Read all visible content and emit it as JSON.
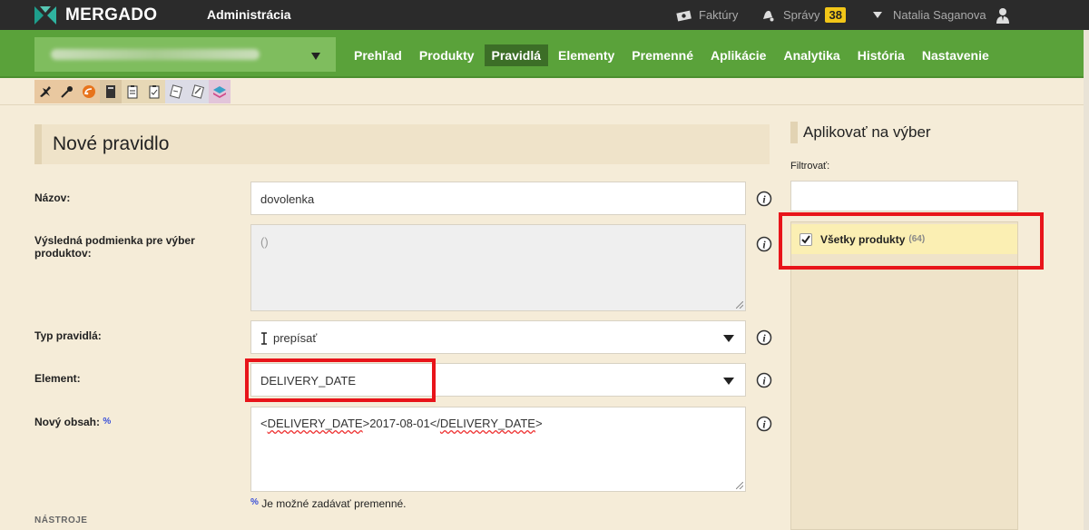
{
  "header": {
    "brand": "MERGADO",
    "section": "Administrácia",
    "invoices_label": "Faktúry",
    "messages_label": "Správy",
    "messages_count": "38",
    "user_name": "Natalia Saganova"
  },
  "nav": {
    "shop_selector": "",
    "items": [
      "Prehľad",
      "Produkty",
      "Pravidlá",
      "Elementy",
      "Premenné",
      "Aplikácie",
      "Analytika",
      "História",
      "Nastavenie"
    ],
    "active": "Pravidlá"
  },
  "toolbar": {
    "icons": [
      "gear-wrench-icon",
      "key-icon",
      "rss-icon",
      "book-icon",
      "clipboard-icon",
      "clipboard-check-icon",
      "note-icon",
      "note-pencil-icon",
      "layers-icon"
    ]
  },
  "form": {
    "title": "Nové pravidlo",
    "name_label": "Názov:",
    "name_value": "dovolenka",
    "condition_label": "Výsledná podmienka pre výber produktov:",
    "condition_value": "()",
    "type_label": "Typ pravidlá:",
    "type_value": "prepísať",
    "element_label": "Element:",
    "element_value": "DELIVERY_DATE",
    "content_label": "Nový obsah:",
    "content_percent": "%",
    "content_tag_open": "DELIVERY_DATE",
    "content_date": "2017-08-01",
    "content_tag_close": "DELIVERY_DATE",
    "hint_percent": "%",
    "hint": "Je možné zadávať premenné.",
    "tools_label": "NÁSTROJE"
  },
  "side": {
    "title": "Aplikovať na výber",
    "filter_label": "Filtrovať:",
    "filter_value": "",
    "item_label": "Všetky produkty",
    "item_count": "(64)",
    "item_checked": true
  },
  "colors": {
    "green": "#5aa23a",
    "active_nav": "#3c6e27",
    "highlight": "#e8141a",
    "badge": "#f2c618"
  }
}
